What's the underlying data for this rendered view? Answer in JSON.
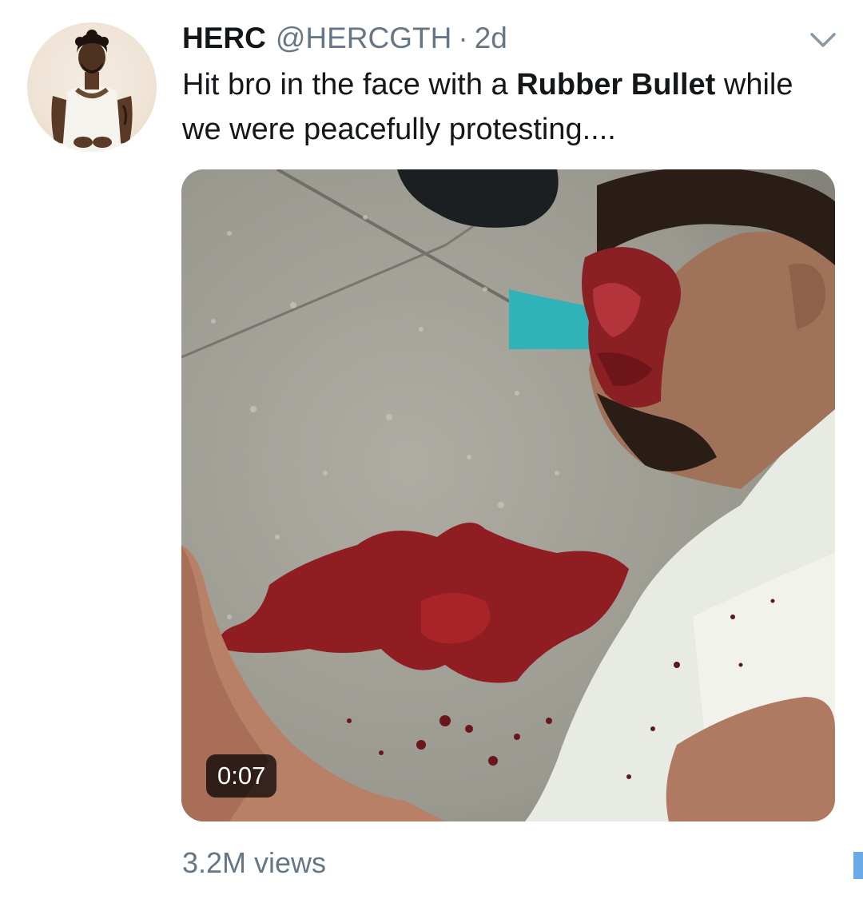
{
  "tweet": {
    "author_name": "HERC",
    "author_handle": "@HERCGTH",
    "separator": "·",
    "timestamp": "2d",
    "text_part1": "Hit bro in the face with a ",
    "text_bold": "Rubber Bullet",
    "text_part2": " while we were peacefully protesting....",
    "video_duration": "0:07",
    "views": "3.2M views"
  },
  "icons": {
    "menu": "chevron-down-icon"
  },
  "colors": {
    "primary_text": "#14171a",
    "secondary_text": "#657786",
    "accent": "#1da1f2"
  }
}
